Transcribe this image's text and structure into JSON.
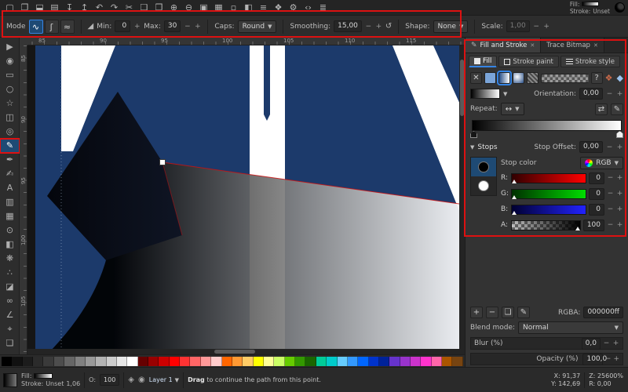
{
  "colors": {
    "annotation": "#dd1111",
    "canvas-blue": "#1c3a6b",
    "accent": "#3584e4",
    "opacity-fill": "#1f5fae"
  },
  "command_bar": {
    "icons": [
      {
        "name": "document-new",
        "glyph": "▢"
      },
      {
        "name": "document-open",
        "glyph": "❐"
      },
      {
        "name": "document-save",
        "glyph": "⬓"
      },
      {
        "name": "print",
        "glyph": "▤"
      },
      {
        "name": "import",
        "glyph": "↧"
      },
      {
        "name": "export",
        "glyph": "↥"
      },
      {
        "name": "undo",
        "glyph": "↶"
      },
      {
        "name": "redo",
        "glyph": "↷"
      },
      {
        "name": "cut",
        "glyph": "✂"
      },
      {
        "name": "copy",
        "glyph": "❏"
      },
      {
        "name": "paste",
        "glyph": "❒"
      },
      {
        "name": "zoom-in",
        "glyph": "⊕"
      },
      {
        "name": "zoom-out",
        "glyph": "⊖"
      },
      {
        "name": "duplicate",
        "glyph": "▣"
      },
      {
        "name": "group",
        "glyph": "▦"
      },
      {
        "name": "ungroup",
        "glyph": "▫"
      },
      {
        "name": "fill-stroke-dialog",
        "glyph": "◧"
      },
      {
        "name": "align-dialog",
        "glyph": "≡"
      },
      {
        "name": "document-properties",
        "glyph": "❖"
      },
      {
        "name": "preferences",
        "glyph": "⚙"
      },
      {
        "name": "xml-editor",
        "glyph": "‹›"
      },
      {
        "name": "layers-dialog",
        "glyph": "≣"
      }
    ],
    "fill_label": "Fill:",
    "stroke_label": "Stroke:",
    "stroke_value": "Unset"
  },
  "tool_options": {
    "mode_label": "Mode",
    "modes": [
      {
        "name": "mode-bezier",
        "glyph": "∿"
      },
      {
        "name": "mode-spiro",
        "glyph": "ʃ"
      },
      {
        "name": "mode-bspline",
        "glyph": "≈"
      }
    ],
    "pressure_icon": "◢",
    "min_label": "Min:",
    "min_value": "0",
    "max_label": "Max:",
    "max_value": "30",
    "caps_label": "Caps:",
    "caps_value": "Round",
    "smoothing_label": "Smoothing:",
    "smoothing_value": "15,00",
    "shape_label": "Shape:",
    "shape_value": "None",
    "scale_label": "Scale:",
    "scale_value": "1,00"
  },
  "toolbox": {
    "tools": [
      {
        "name": "selector",
        "glyph": "▶"
      },
      {
        "name": "node-editor",
        "glyph": "◉"
      },
      {
        "name": "rectangle",
        "glyph": "▭"
      },
      {
        "name": "ellipse",
        "glyph": "○"
      },
      {
        "name": "star",
        "glyph": "☆"
      },
      {
        "name": "box-3d",
        "glyph": "◫"
      },
      {
        "name": "spiral",
        "glyph": "◎"
      },
      {
        "name": "pencil",
        "glyph": "✎",
        "active": true,
        "annotated": true
      },
      {
        "name": "bezier-pen",
        "glyph": "✒"
      },
      {
        "name": "calligraphy",
        "glyph": "✍"
      },
      {
        "name": "text",
        "glyph": "A"
      },
      {
        "name": "gradient",
        "glyph": "▥"
      },
      {
        "name": "mesh-gradient",
        "glyph": "▦"
      },
      {
        "name": "dropper",
        "glyph": "⊙"
      },
      {
        "name": "paint-bucket",
        "glyph": "◧"
      },
      {
        "name": "tweak",
        "glyph": "❋"
      },
      {
        "name": "spray",
        "glyph": "∴"
      },
      {
        "name": "eraser",
        "glyph": "◪"
      },
      {
        "name": "connector",
        "glyph": "∞"
      },
      {
        "name": "measure",
        "glyph": "∠"
      },
      {
        "name": "zoom",
        "glyph": "⌖"
      },
      {
        "name": "pages",
        "glyph": "❏"
      }
    ]
  },
  "rulers": {
    "horizontal": [
      "85",
      "90",
      "95",
      "100",
      "105",
      "110",
      "115"
    ],
    "vertical": [
      "85",
      "90",
      "95",
      "100",
      "105"
    ]
  },
  "right_panel": {
    "tabs": [
      {
        "label": "Fill and Stroke",
        "icon": "✎",
        "close_icon": "✕"
      },
      {
        "label": "Trace Bitmap",
        "close_icon": "✕"
      }
    ],
    "paint_tabs": [
      {
        "label": "Fill"
      },
      {
        "label": "Stroke paint"
      },
      {
        "label": "Stroke style"
      }
    ],
    "fill_types": [
      {
        "name": "no-paint",
        "glyph": "✕"
      },
      {
        "name": "flat-color"
      },
      {
        "name": "linear-gradient"
      },
      {
        "name": "radial-gradient"
      },
      {
        "name": "pattern"
      },
      {
        "name": "swatch"
      },
      {
        "name": "unknown",
        "glyph": "?"
      }
    ],
    "orientation_label": "Orientation:",
    "orientation_value": "0,00",
    "repeat_label": "Repeat:",
    "repeat_glyph": "↔",
    "stops_label": "Stops",
    "stop_offset_label": "Stop Offset:",
    "stop_offset_value": "0,00",
    "stop_color_label": "Stop color",
    "color_mode": "RGB",
    "sliders": [
      {
        "label": "R:",
        "value": "0"
      },
      {
        "label": "G:",
        "value": "0"
      },
      {
        "label": "B:",
        "value": "0"
      },
      {
        "label": "A:",
        "value": "100"
      }
    ],
    "rgba_label": "RGBA:",
    "rgba_value": "000000ff",
    "blend_label": "Blend mode:",
    "blend_value": "Normal",
    "blur_label": "Blur (%)",
    "blur_value": "0,0",
    "opacity_label": "Opacity (%)",
    "opacity_value": "100,0"
  },
  "palette": {
    "colors": [
      "#000000",
      "#111111",
      "#1c1c1c",
      "#2b2b2b",
      "#3a3a3a",
      "#4d4d4d",
      "#666666",
      "#808080",
      "#999999",
      "#b3b3b3",
      "#cccccc",
      "#e6e6e6",
      "#ffffff",
      "#660000",
      "#990000",
      "#cc0000",
      "#ff0000",
      "#ff3333",
      "#ff6666",
      "#ff9999",
      "#ffcccc",
      "#ff6600",
      "#ff9933",
      "#ffcc66",
      "#ffff00",
      "#ffff99",
      "#ccff66",
      "#66cc00",
      "#339900",
      "#1a6600",
      "#00cc99",
      "#00cccc",
      "#66ccff",
      "#3399ff",
      "#0066ff",
      "#0033cc",
      "#002299",
      "#6633cc",
      "#9933cc",
      "#cc33cc",
      "#ff33cc",
      "#ff66aa",
      "#aa5500",
      "#774411"
    ]
  },
  "status_bar": {
    "fill_label": "Fill:",
    "stroke_label": "Stroke:",
    "stroke_value": "Unset",
    "stroke_width": "1,06",
    "opacity_label": "O:",
    "opacity_value": "100",
    "layer_name": "Layer 1",
    "message_strong": "Drag",
    "message_rest": " to continue the path from this point.",
    "x_label": "X:",
    "x_value": "91,37",
    "y_label": "Y:",
    "y_value": "142,69",
    "z_label": "Z:",
    "z_value": "25600%",
    "r_label": "R:",
    "r_value": "0,00"
  }
}
